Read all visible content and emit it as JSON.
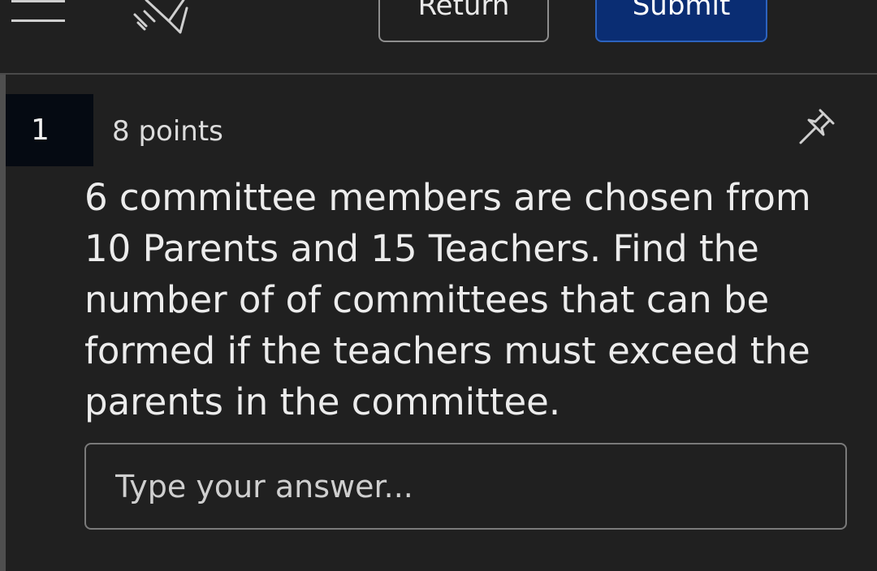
{
  "toolbar": {
    "menu_icon": "hamburger-menu-icon",
    "pen_icon": "pen-strike-icon",
    "return_label": "Return",
    "submit_label": "Submit",
    "submit_color": "#0a2d73"
  },
  "question": {
    "number": "1",
    "points": "8 points",
    "pin_icon": "pin-icon",
    "text": "6 committee members are chosen from 10 Parents and 15 Teachers. Find the number of of committees that can be formed if the teachers must exceed the parents in the committee.",
    "answer_value": "",
    "answer_placeholder": "Type your answer..."
  }
}
